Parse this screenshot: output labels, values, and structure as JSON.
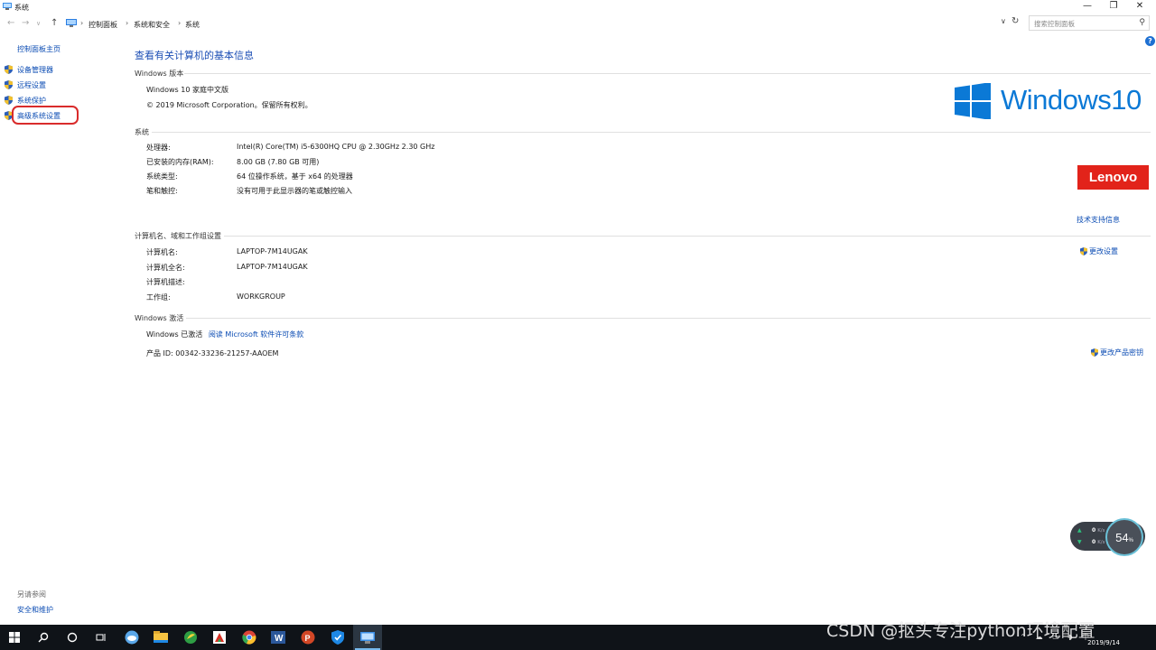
{
  "window": {
    "title": "系统",
    "controls": {
      "minimize": "—",
      "restore": "❐",
      "close": "✕"
    }
  },
  "address": {
    "breadcrumbs": [
      "控制面板",
      "系统和安全",
      "系统"
    ],
    "search_placeholder": "搜索控制面板"
  },
  "sidebar": {
    "home": "控制面板主页",
    "items": [
      {
        "label": "设备管理器"
      },
      {
        "label": "远程设置"
      },
      {
        "label": "系统保护"
      },
      {
        "label": "高级系统设置",
        "highlighted": true
      }
    ],
    "see_also": "另请参阅",
    "security_link": "安全和维护"
  },
  "main": {
    "title": "查看有关计算机的基本信息",
    "edition_section": {
      "heading": "Windows 版本",
      "edition": "Windows 10 家庭中文版",
      "copyright": "© 2019 Microsoft Corporation。保留所有权利。"
    },
    "system_section": {
      "heading": "系统",
      "rows": [
        {
          "label": "处理器:",
          "value": "Intel(R) Core(TM) i5-6300HQ CPU @ 2.30GHz   2.30 GHz"
        },
        {
          "label": "已安装的内存(RAM):",
          "value": "8.00 GB (7.80 GB 可用)"
        },
        {
          "label": "系统类型:",
          "value": "64 位操作系统，基于 x64 的处理器"
        },
        {
          "label": "笔和触控:",
          "value": "没有可用于此显示器的笔或触控输入"
        }
      ],
      "support_link": "技术支持信息"
    },
    "computer_section": {
      "heading": "计算机名、域和工作组设置",
      "rows": [
        {
          "label": "计算机名:",
          "value": "LAPTOP-7M14UGAK"
        },
        {
          "label": "计算机全名:",
          "value": "LAPTOP-7M14UGAK"
        },
        {
          "label": "计算机描述:",
          "value": ""
        },
        {
          "label": "工作组:",
          "value": "WORKGROUP"
        }
      ],
      "change_link": "更改设置"
    },
    "activation_section": {
      "heading": "Windows 激活",
      "status": "Windows 已激活",
      "license_link": "阅读 Microsoft 软件许可条款",
      "product_id": "产品 ID: 00342-33236-21257-AAOEM",
      "change_key_link": "更改产品密钥"
    },
    "logo_text": "Windows10",
    "oem_logo": "Lenovo"
  },
  "widget": {
    "upload": "0",
    "download": "0",
    "unit": "K/s",
    "percent": "54",
    "percent_unit": "%"
  },
  "taskbar": {
    "date": "2019/9/14"
  },
  "watermark": "CSDN @抠头专注python环境配置",
  "colors": {
    "link": "#0a4bb3",
    "title": "#1d4fb5",
    "highlight_ring": "#d92b2b",
    "windows_blue": "#0b79d6",
    "lenovo_red": "#e2231a",
    "taskbar": "#0f1318"
  }
}
